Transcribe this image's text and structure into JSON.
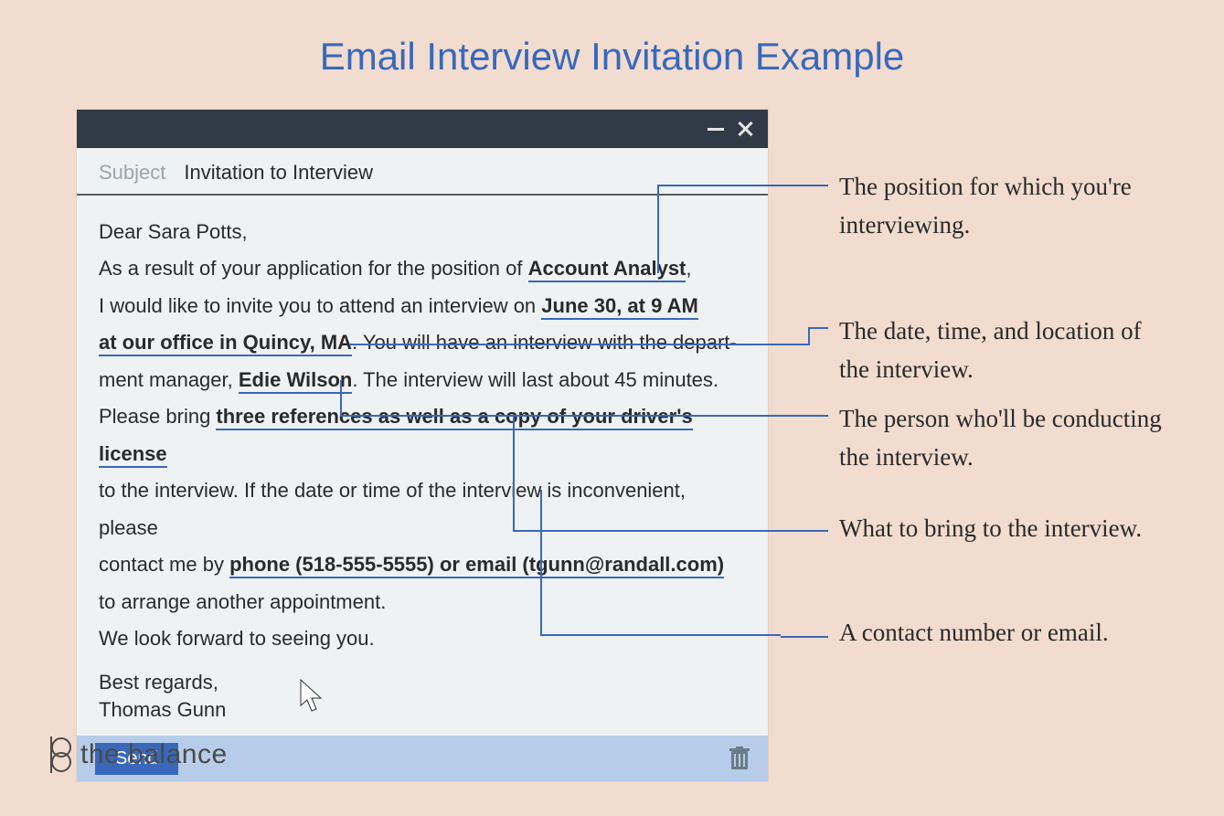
{
  "page": {
    "title": "Email Interview Invitation Example"
  },
  "window": {
    "subject_label": "Subject",
    "subject_value": "Invitation to Interview",
    "minimize": "minimize",
    "close": "close"
  },
  "body": {
    "greeting": "Dear Sara Potts,",
    "p1_pre": "As a result of your application for the position of ",
    "position": "Account Analyst",
    "p1_post": ",",
    "p2_pre": "I  would like to invite you to attend an interview on ",
    "datetime_a": "June 30, at 9 AM",
    "datetime_b": "at our office in Quincy, MA",
    "p2_mid": ". You will have an interview with the depart-",
    "p3_pre": "ment manager, ",
    "interviewer": "Edie Wilson",
    "p3_post": ". The interview will last about 45 minutes.",
    "p4_pre": "Please bring ",
    "bring": "three references as well as a copy of your driver's license",
    "p5": "to the interview. If the date or time of the interview is inconvenient, please",
    "p6_pre": "contact me by ",
    "contact": "phone (518-555-5555) or email (tgunn@randall.com)",
    "p7": "to arrange another appointment.",
    "p8": "We look forward to seeing you.",
    "sig1": "Best regards,",
    "sig2": "Thomas Gunn"
  },
  "toolbar": {
    "send": "Send"
  },
  "annotations": {
    "a1": "The position for which you're interviewing.",
    "a2": "The date, time, and location of the interview.",
    "a3": "The person who'll be conducting the interview.",
    "a4": "What to bring to the interview.",
    "a5": "A contact number or email."
  },
  "brand": {
    "name": "the balance"
  },
  "colors": {
    "accent": "#3968bb",
    "background": "#f1dccf"
  }
}
